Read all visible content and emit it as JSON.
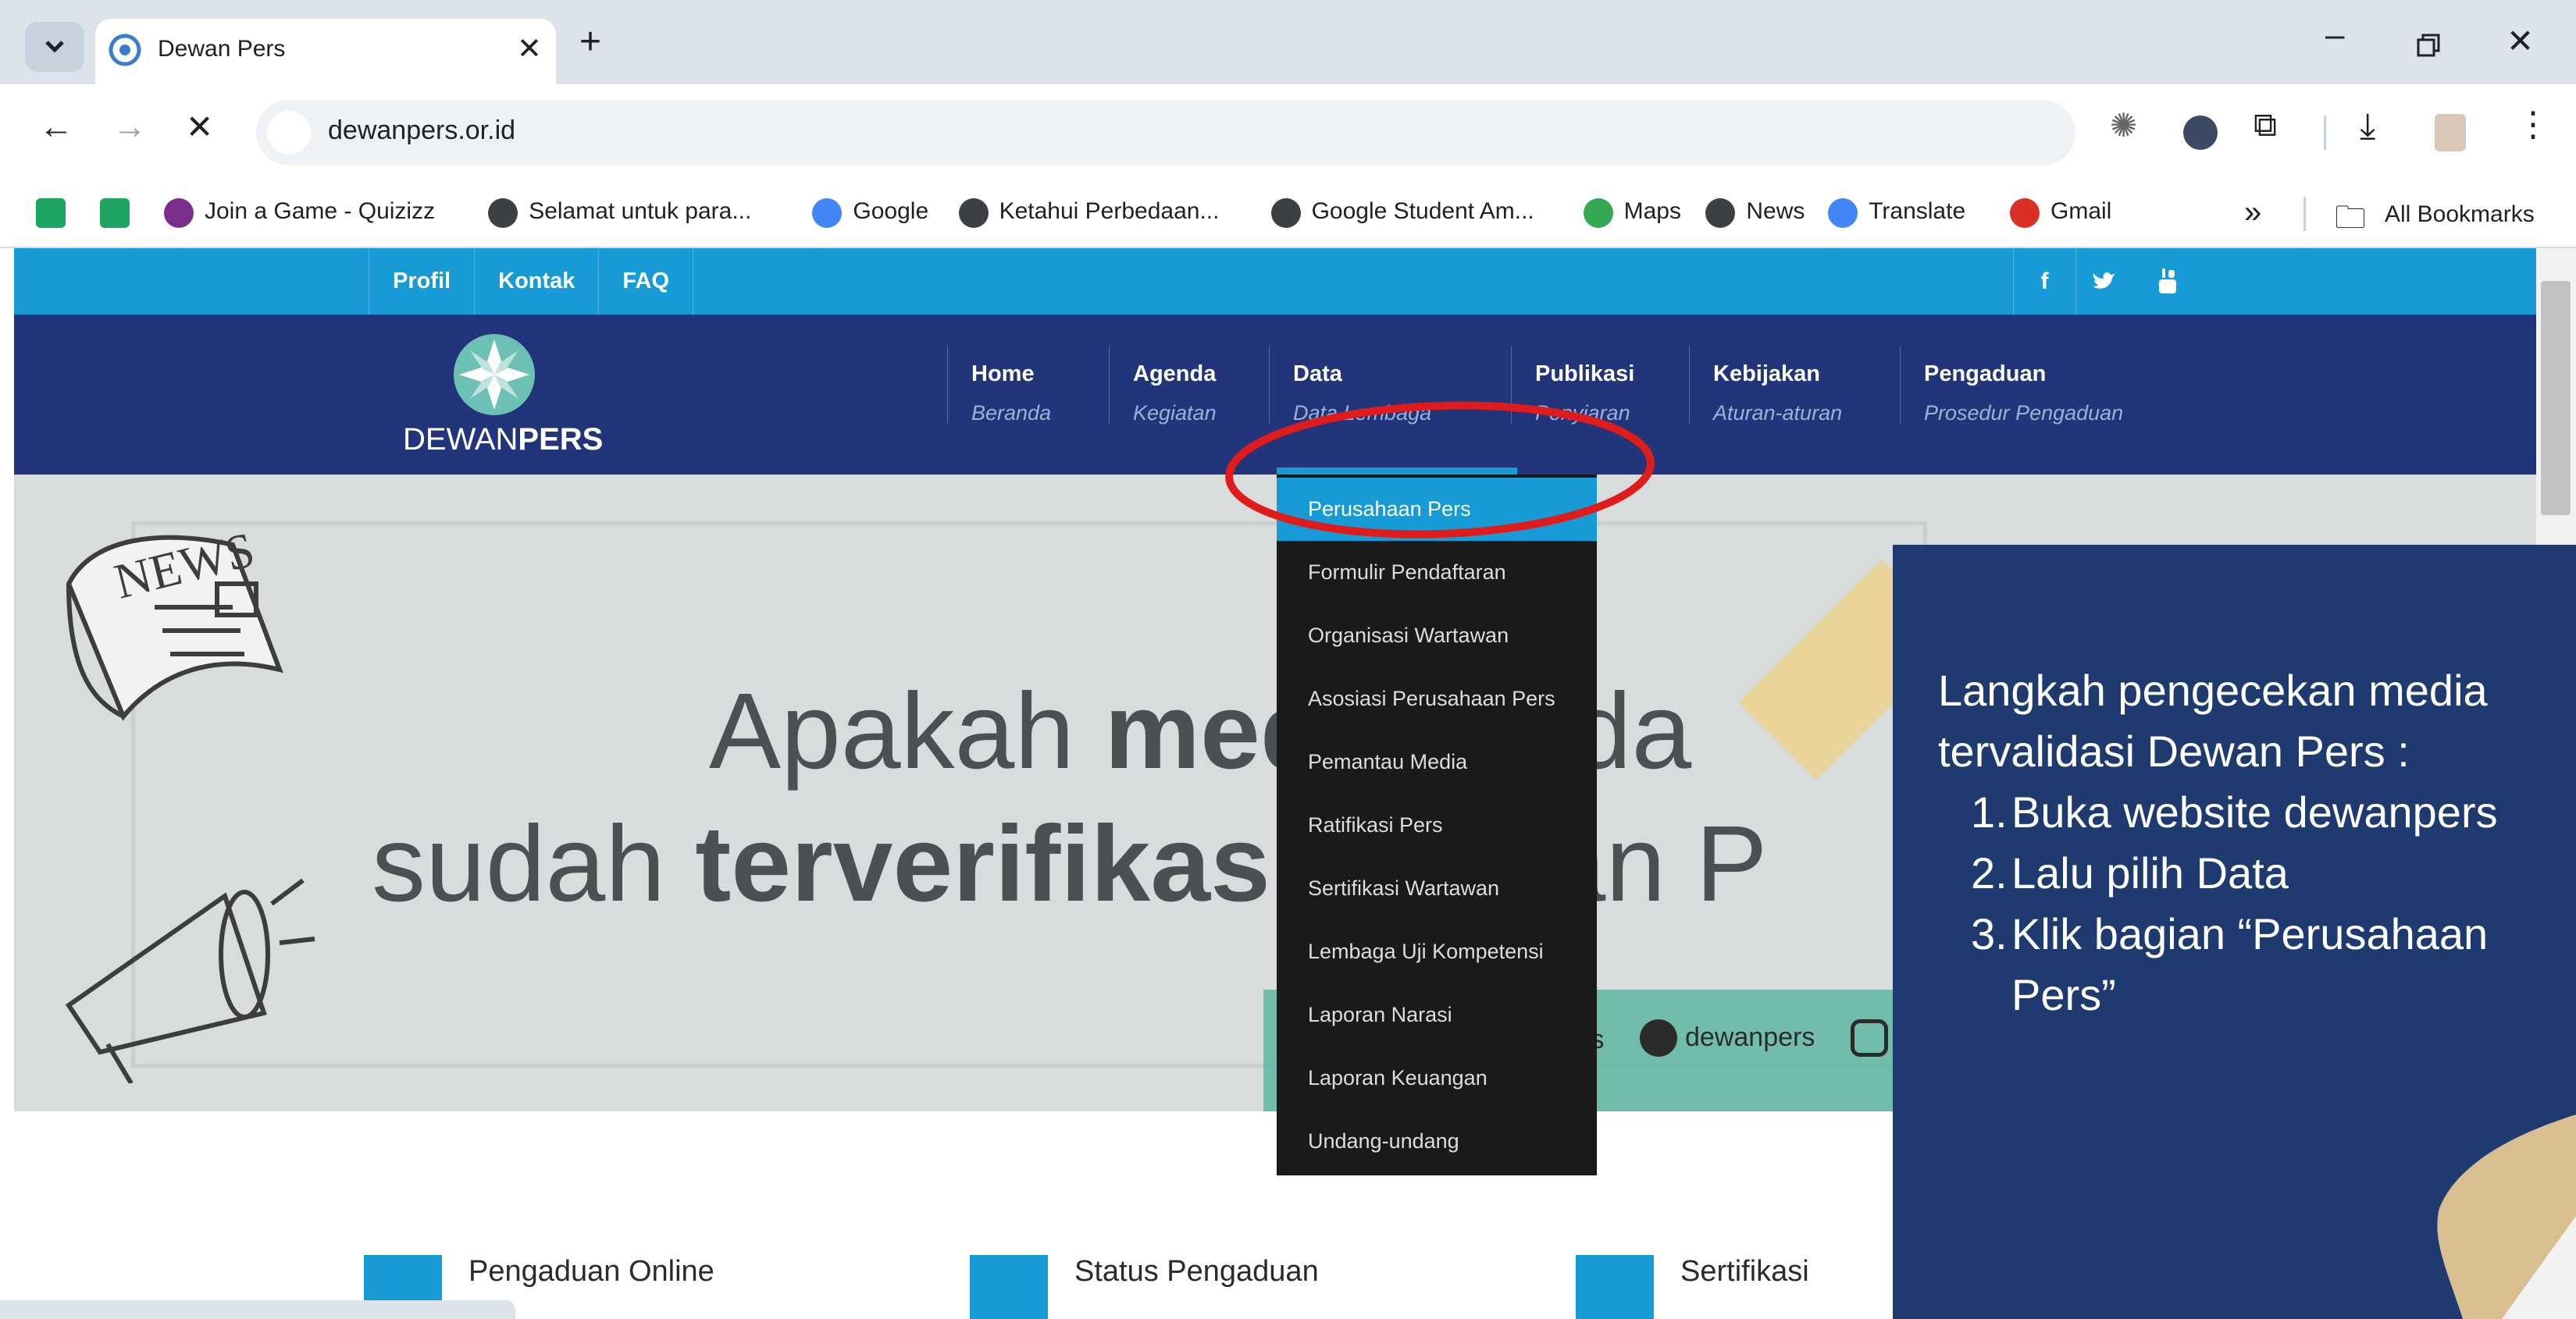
{
  "browser": {
    "tab_title": "Dewan Pers",
    "url": "dewanpers.or.id",
    "new_tab": "+",
    "bookmarks": [
      {
        "label": "",
        "icon": "sheets-icon"
      },
      {
        "label": "",
        "icon": "sheets-icon"
      },
      {
        "label": "Join a Game - Quizizz",
        "icon": "quizizz-icon"
      },
      {
        "label": "Selamat untuk para...",
        "icon": "globe-icon"
      },
      {
        "label": "Google",
        "icon": "google-icon"
      },
      {
        "label": "Ketahui Perbedaan...",
        "icon": "globe-icon"
      },
      {
        "label": "Google Student Am...",
        "icon": "globe-icon"
      },
      {
        "label": "Maps",
        "icon": "maps-icon"
      },
      {
        "label": "News",
        "icon": "globe-icon"
      },
      {
        "label": "Translate",
        "icon": "translate-icon"
      },
      {
        "label": "Gmail",
        "icon": "gmail-icon"
      }
    ],
    "more_bookmarks": "»",
    "all_bookmarks": "All Bookmarks"
  },
  "site": {
    "top_links": [
      "Profil",
      "Kontak",
      "FAQ"
    ],
    "logo_text_light": "DEWAN",
    "logo_text_bold": "PERS",
    "nav": [
      {
        "title": "Home",
        "sub": "Beranda"
      },
      {
        "title": "Agenda",
        "sub": "Kegiatan"
      },
      {
        "title": "Data",
        "sub": "Data Lembaga"
      },
      {
        "title": "Publikasi",
        "sub": "Penyiaran"
      },
      {
        "title": "Kebijakan",
        "sub": "Aturan-aturan"
      },
      {
        "title": "Pengaduan",
        "sub": "Prosedur Pengaduan"
      }
    ],
    "dropdown": [
      "Perusahaan Pers",
      "Formulir Pendaftaran",
      "Organisasi Wartawan",
      "Asosiasi Perusahaan Pers",
      "Pemantau Media",
      "Ratifikasi Pers",
      "Sertifikasi Wartawan",
      "Lembaga Uji Kompetensi",
      "Laporan Narasi",
      "Laporan Keuangan",
      "Undang-undang"
    ],
    "hero": {
      "line1_a": "Apakah ",
      "line1_b": "media",
      "line1_c": " Anda",
      "line2_a": "sudah ",
      "line2_b": "terverifikasi",
      "line2_c": " Dewan P",
      "news_word": "NEWS",
      "social_1": "dewanpers",
      "social_2": "dewanpers"
    },
    "features": [
      "Pengaduan Online",
      "Status Pengaduan",
      "Sertifikasi"
    ]
  },
  "panel": {
    "intro": "Langkah pengecekan media tervalidasi Dewan Pers :",
    "steps": [
      "Buka website dewanpers",
      "Lalu pilih Data",
      "Klik bagian “Perusahaan Pers”"
    ]
  },
  "colors": {
    "accent": "#179bd7",
    "navy": "#22357a",
    "highlight": "#e01b1b",
    "panel": "#1e3a6e"
  }
}
